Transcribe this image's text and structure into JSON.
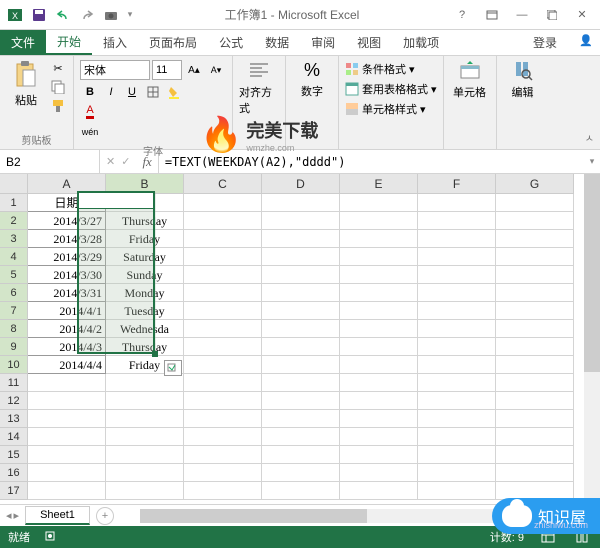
{
  "title": "工作簿1 - Microsoft Excel",
  "tabs": {
    "file": "文件",
    "home": "开始",
    "insert": "插入",
    "layout": "页面布局",
    "formulas": "公式",
    "data": "数据",
    "review": "审阅",
    "view": "视图",
    "addins": "加载项",
    "login": "登录"
  },
  "ribbon": {
    "clipboard": {
      "paste": "粘贴",
      "label": "剪贴板"
    },
    "font": {
      "name": "宋体",
      "size": "11",
      "label": "字体",
      "wen": "wén"
    },
    "align": {
      "label": "对齐方式"
    },
    "number": {
      "label": "数字",
      "percent": "%"
    },
    "styles": {
      "cond": "条件格式",
      "table": "套用表格格式",
      "cell": "单元格样式"
    },
    "cells": {
      "label": "单元格"
    },
    "editing": {
      "label": "编辑"
    }
  },
  "watermark": {
    "main": "完美下载",
    "sub": "wmzhe.com"
  },
  "namebox": "B2",
  "formula": "=TEXT(WEEKDAY(A2),\"dddd\")",
  "columns": [
    "A",
    "B",
    "C",
    "D",
    "E",
    "F",
    "G"
  ],
  "rows": [
    "1",
    "2",
    "3",
    "4",
    "5",
    "6",
    "7",
    "8",
    "9",
    "10",
    "11",
    "12",
    "13",
    "14",
    "15",
    "16",
    "17"
  ],
  "header_A": "日期",
  "data_A": [
    "2014/3/27",
    "2014/3/28",
    "2014/3/29",
    "2014/3/30",
    "2014/3/31",
    "2014/4/1",
    "2014/4/2",
    "2014/4/3",
    "2014/4/4"
  ],
  "data_B": [
    "Thursday",
    "Friday",
    "Saturday",
    "Sunday",
    "Monday",
    "Tuesday",
    "Wednesda",
    "Thursday",
    "Friday"
  ],
  "sheet": {
    "name": "Sheet1"
  },
  "status": {
    "ready": "就绪",
    "count_lbl": "计数:",
    "count": "9"
  },
  "badge": {
    "text": "知识屋",
    "sub": "zhishiwu.com"
  }
}
